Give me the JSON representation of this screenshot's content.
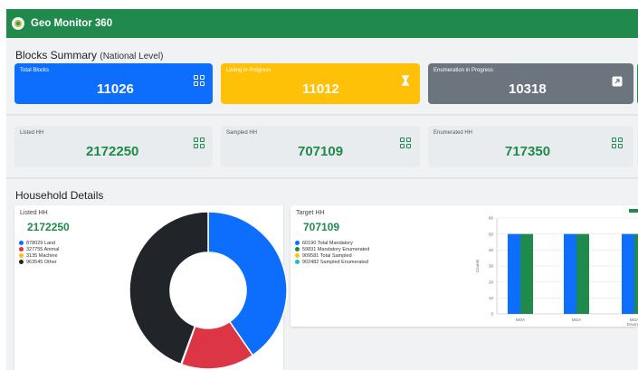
{
  "app": {
    "title": "Geo Monitor 360"
  },
  "blocks_summary": {
    "title": "Blocks Summary",
    "subtitle": "(National Level)",
    "cards": [
      {
        "label": "Total Blocks",
        "value": "11026",
        "icon": "grid-icon",
        "color": "#0d6efd"
      },
      {
        "label": "Listing in Progress",
        "value": "11012",
        "icon": "hourglass-icon",
        "color": "#ffc107"
      },
      {
        "label": "Enumeration in Progress",
        "value": "10318",
        "icon": "external-link-icon",
        "color": "#6c757d"
      }
    ]
  },
  "hh_cards": [
    {
      "label": "Listed HH",
      "value": "2172250",
      "icon": "grid-icon"
    },
    {
      "label": "Sampled HH",
      "value": "707109",
      "icon": "grid-icon"
    },
    {
      "label": "Enumerated HH",
      "value": "717350",
      "icon": "grid-icon"
    }
  ],
  "household_details": {
    "title": "Household Details",
    "listed_panel": {
      "label": "Listed HH",
      "value": "2172250",
      "legend": [
        {
          "text": "878029 Land",
          "color": "#0d6efd"
        },
        {
          "text": "327755 Animal",
          "color": "#dc3545"
        },
        {
          "text": "3135 Machine",
          "color": "#ffc107"
        },
        {
          "text": "963545 Other",
          "color": "#212529"
        }
      ]
    },
    "target_panel": {
      "label": "Target HH",
      "value": "707109",
      "legend": [
        {
          "text": "60190 Total Mandatory",
          "color": "#0d6efd"
        },
        {
          "text": "59831 Mandatory Enumerated",
          "color": "#1e8a4c"
        },
        {
          "text": "909581 Total Sampled",
          "color": "#ffc107"
        },
        {
          "text": "902482 Sampled Enumerated",
          "color": "#17becf"
        }
      ]
    }
  },
  "chart_data": [
    {
      "type": "pie",
      "variant": "donut",
      "labels": [
        "Land",
        "Animal",
        "Machine",
        "Other"
      ],
      "values": [
        878029,
        327755,
        3135,
        963545
      ],
      "colors": [
        "#0d6efd",
        "#dc3545",
        "#ffc107",
        "#212529"
      ]
    },
    {
      "type": "bar",
      "categories": [
        "MOA",
        "MOA",
        "MOA"
      ],
      "series": [
        {
          "values": [
            50,
            50,
            50
          ],
          "color": "#0d6efd"
        },
        {
          "values": [
            50,
            50,
            50
          ],
          "color": "#1e8a4c"
        }
      ],
      "ylabel": "Counts",
      "xlabel": "Enumerat",
      "ylim": [
        0,
        60
      ],
      "yticks": [
        "0",
        "10",
        "20",
        "30",
        "40",
        "50",
        "60"
      ],
      "grid": true,
      "legend_placement": "top-right"
    }
  ]
}
